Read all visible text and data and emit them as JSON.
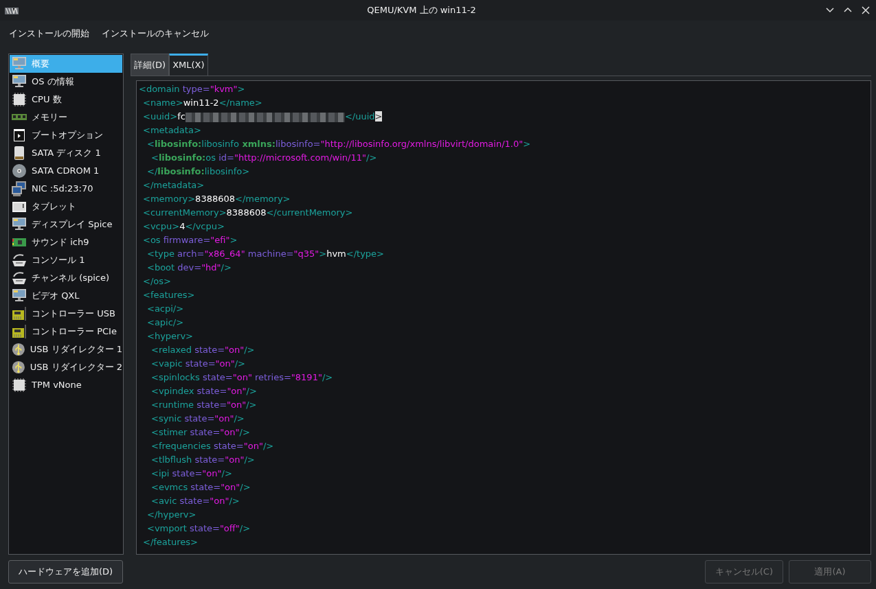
{
  "window": {
    "title": "QEMU/KVM 上の win11-2"
  },
  "menu": [
    "インストールの開始",
    "インストールのキャンセル"
  ],
  "sidebar": {
    "items": [
      {
        "label": "概要",
        "kind": "monitor",
        "selected": true
      },
      {
        "label": "OS の情報",
        "kind": "monitor",
        "selected": false
      },
      {
        "label": "CPU 数",
        "kind": "chip",
        "selected": false
      },
      {
        "label": "メモリー",
        "kind": "ram",
        "selected": false
      },
      {
        "label": "ブートオプション",
        "kind": "boot",
        "selected": false
      },
      {
        "label": "SATA ディスク 1",
        "kind": "disk",
        "selected": false
      },
      {
        "label": "SATA CDROM 1",
        "kind": "cd",
        "selected": false
      },
      {
        "label": "NIC :5d:23:70",
        "kind": "nic",
        "selected": false
      },
      {
        "label": "タブレット",
        "kind": "tablet",
        "selected": false
      },
      {
        "label": "ディスプレイ Spice",
        "kind": "monitor",
        "selected": false
      },
      {
        "label": "サウンド ich9",
        "kind": "card",
        "selected": false
      },
      {
        "label": "コンソール 1",
        "kind": "serial",
        "selected": false
      },
      {
        "label": "チャンネル (spice)",
        "kind": "serial",
        "selected": false
      },
      {
        "label": "ビデオ QXL",
        "kind": "monitor",
        "selected": false
      },
      {
        "label": "コントローラー USB",
        "kind": "controller",
        "selected": false
      },
      {
        "label": "コントローラー PCIe",
        "kind": "controller",
        "selected": false
      },
      {
        "label": "USB リダイレクター 1",
        "kind": "usb",
        "selected": false
      },
      {
        "label": "USB リダイレクター 2",
        "kind": "usb",
        "selected": false
      },
      {
        "label": "TPM vNone",
        "kind": "chip",
        "selected": false
      }
    ]
  },
  "tabs": [
    {
      "label": "詳細(D)",
      "selected": false
    },
    {
      "label": "XML(X)",
      "selected": true
    }
  ],
  "xml": [
    {
      "parts": [
        {
          "kind": "tag",
          "text": "<domain"
        },
        {
          "kind": "attr",
          "text": " type="
        },
        {
          "kind": "value",
          "text": "\"kvm\""
        },
        {
          "kind": "tag",
          "text": ">"
        }
      ],
      "children": [
        {
          "parts": [
            {
              "kind": "tag",
              "text": "<name>"
            },
            {
              "kind": "text",
              "text": "win11-2"
            },
            {
              "kind": "tag",
              "text": "</name>"
            }
          ]
        },
        {
          "parts": [
            {
              "kind": "tag",
              "text": "<uuid>"
            },
            {
              "kind": "text",
              "text": "fc"
            },
            {
              "kind": "redacted"
            },
            {
              "kind": "tag",
              "text": "</uuid"
            },
            {
              "kind": "cursor",
              "text": ">"
            }
          ]
        },
        {
          "parts": [
            {
              "kind": "tag",
              "text": "<metadata>"
            }
          ],
          "children": [
            {
              "parts": [
                {
                  "kind": "tag",
                  "text": "<"
                },
                {
                  "kind": "prefix",
                  "text": "libosinfo:"
                },
                {
                  "kind": "tag",
                  "text": "libosinfo"
                },
                {
                  "kind": "prefix",
                  "text": " xmlns:"
                },
                {
                  "kind": "attr",
                  "text": "libosinfo="
                },
                {
                  "kind": "value",
                  "text": "\"http://libosinfo.org/xmlns/libvirt/domain/1.0\""
                },
                {
                  "kind": "tag",
                  "text": ">"
                }
              ],
              "children": [
                {
                  "parts": [
                    {
                      "kind": "tag",
                      "text": "<"
                    },
                    {
                      "kind": "prefix",
                      "text": "libosinfo:"
                    },
                    {
                      "kind": "tag",
                      "text": "os"
                    },
                    {
                      "kind": "attr",
                      "text": " id="
                    },
                    {
                      "kind": "value",
                      "text": "\"http://microsoft.com/win/11\""
                    },
                    {
                      "kind": "tag",
                      "text": "/>"
                    }
                  ]
                }
              ]
            },
            {
              "parts": [
                {
                  "kind": "tag",
                  "text": "</"
                },
                {
                  "kind": "prefix",
                  "text": "libosinfo:"
                },
                {
                  "kind": "tag",
                  "text": "libosinfo>"
                }
              ]
            }
          ]
        },
        {
          "parts": [
            {
              "kind": "tag",
              "text": "</metadata>"
            }
          ]
        },
        {
          "parts": [
            {
              "kind": "tag",
              "text": "<memory>"
            },
            {
              "kind": "text",
              "text": "8388608"
            },
            {
              "kind": "tag",
              "text": "</memory>"
            }
          ]
        },
        {
          "parts": [
            {
              "kind": "tag",
              "text": "<currentMemory>"
            },
            {
              "kind": "text",
              "text": "8388608"
            },
            {
              "kind": "tag",
              "text": "</currentMemory>"
            }
          ]
        },
        {
          "parts": [
            {
              "kind": "tag",
              "text": "<vcpu>"
            },
            {
              "kind": "text",
              "text": "4"
            },
            {
              "kind": "tag",
              "text": "</vcpu>"
            }
          ]
        },
        {
          "parts": [
            {
              "kind": "tag",
              "text": "<os"
            },
            {
              "kind": "attr",
              "text": " firmware="
            },
            {
              "kind": "value",
              "text": "\"efi\""
            },
            {
              "kind": "tag",
              "text": ">"
            }
          ],
          "children": [
            {
              "parts": [
                {
                  "kind": "tag",
                  "text": "<type"
                },
                {
                  "kind": "attr",
                  "text": " arch="
                },
                {
                  "kind": "value",
                  "text": "\"x86_64\""
                },
                {
                  "kind": "attr",
                  "text": " machine="
                },
                {
                  "kind": "value",
                  "text": "\"q35\""
                },
                {
                  "kind": "tag",
                  "text": ">"
                },
                {
                  "kind": "text",
                  "text": "hvm"
                },
                {
                  "kind": "tag",
                  "text": "</type>"
                }
              ]
            },
            {
              "parts": [
                {
                  "kind": "tag",
                  "text": "<boot"
                },
                {
                  "kind": "attr",
                  "text": " dev="
                },
                {
                  "kind": "value",
                  "text": "\"hd\""
                },
                {
                  "kind": "tag",
                  "text": "/>"
                }
              ]
            }
          ]
        },
        {
          "parts": [
            {
              "kind": "tag",
              "text": "</os>"
            }
          ]
        },
        {
          "parts": [
            {
              "kind": "tag",
              "text": "<features>"
            }
          ],
          "children": [
            {
              "parts": [
                {
                  "kind": "tag",
                  "text": "<acpi/>"
                }
              ]
            },
            {
              "parts": [
                {
                  "kind": "tag",
                  "text": "<apic/>"
                }
              ]
            },
            {
              "parts": [
                {
                  "kind": "tag",
                  "text": "<hyperv>"
                }
              ],
              "children": [
                {
                  "parts": [
                    {
                      "kind": "tag",
                      "text": "<relaxed"
                    },
                    {
                      "kind": "attr",
                      "text": " state="
                    },
                    {
                      "kind": "value",
                      "text": "\"on\""
                    },
                    {
                      "kind": "tag",
                      "text": "/>"
                    }
                  ]
                },
                {
                  "parts": [
                    {
                      "kind": "tag",
                      "text": "<vapic"
                    },
                    {
                      "kind": "attr",
                      "text": " state="
                    },
                    {
                      "kind": "value",
                      "text": "\"on\""
                    },
                    {
                      "kind": "tag",
                      "text": "/>"
                    }
                  ]
                },
                {
                  "parts": [
                    {
                      "kind": "tag",
                      "text": "<spinlocks"
                    },
                    {
                      "kind": "attr",
                      "text": " state="
                    },
                    {
                      "kind": "value",
                      "text": "\"on\""
                    },
                    {
                      "kind": "attr",
                      "text": " retries="
                    },
                    {
                      "kind": "value",
                      "text": "\"8191\""
                    },
                    {
                      "kind": "tag",
                      "text": "/>"
                    }
                  ]
                },
                {
                  "parts": [
                    {
                      "kind": "tag",
                      "text": "<vpindex"
                    },
                    {
                      "kind": "attr",
                      "text": " state="
                    },
                    {
                      "kind": "value",
                      "text": "\"on\""
                    },
                    {
                      "kind": "tag",
                      "text": "/>"
                    }
                  ]
                },
                {
                  "parts": [
                    {
                      "kind": "tag",
                      "text": "<runtime"
                    },
                    {
                      "kind": "attr",
                      "text": " state="
                    },
                    {
                      "kind": "value",
                      "text": "\"on\""
                    },
                    {
                      "kind": "tag",
                      "text": "/>"
                    }
                  ]
                },
                {
                  "parts": [
                    {
                      "kind": "tag",
                      "text": "<synic"
                    },
                    {
                      "kind": "attr",
                      "text": " state="
                    },
                    {
                      "kind": "value",
                      "text": "\"on\""
                    },
                    {
                      "kind": "tag",
                      "text": "/>"
                    }
                  ]
                },
                {
                  "parts": [
                    {
                      "kind": "tag",
                      "text": "<stimer"
                    },
                    {
                      "kind": "attr",
                      "text": " state="
                    },
                    {
                      "kind": "value",
                      "text": "\"on\""
                    },
                    {
                      "kind": "tag",
                      "text": "/>"
                    }
                  ]
                },
                {
                  "parts": [
                    {
                      "kind": "tag",
                      "text": "<frequencies"
                    },
                    {
                      "kind": "attr",
                      "text": " state="
                    },
                    {
                      "kind": "value",
                      "text": "\"on\""
                    },
                    {
                      "kind": "tag",
                      "text": "/>"
                    }
                  ]
                },
                {
                  "parts": [
                    {
                      "kind": "tag",
                      "text": "<tlbflush"
                    },
                    {
                      "kind": "attr",
                      "text": " state="
                    },
                    {
                      "kind": "value",
                      "text": "\"on\""
                    },
                    {
                      "kind": "tag",
                      "text": "/>"
                    }
                  ]
                },
                {
                  "parts": [
                    {
                      "kind": "tag",
                      "text": "<ipi"
                    },
                    {
                      "kind": "attr",
                      "text": " state="
                    },
                    {
                      "kind": "value",
                      "text": "\"on\""
                    },
                    {
                      "kind": "tag",
                      "text": "/>"
                    }
                  ]
                },
                {
                  "parts": [
                    {
                      "kind": "tag",
                      "text": "<evmcs"
                    },
                    {
                      "kind": "attr",
                      "text": " state="
                    },
                    {
                      "kind": "value",
                      "text": "\"on\""
                    },
                    {
                      "kind": "tag",
                      "text": "/>"
                    }
                  ]
                },
                {
                  "parts": [
                    {
                      "kind": "tag",
                      "text": "<avic"
                    },
                    {
                      "kind": "attr",
                      "text": " state="
                    },
                    {
                      "kind": "value",
                      "text": "\"on\""
                    },
                    {
                      "kind": "tag",
                      "text": "/>"
                    }
                  ]
                }
              ]
            },
            {
              "parts": [
                {
                  "kind": "tag",
                  "text": "</hyperv>"
                }
              ]
            },
            {
              "parts": [
                {
                  "kind": "tag",
                  "text": "<vmport"
                },
                {
                  "kind": "attr",
                  "text": " state="
                },
                {
                  "kind": "value",
                  "text": "\"off\""
                },
                {
                  "kind": "tag",
                  "text": "/>"
                }
              ]
            }
          ]
        },
        {
          "parts": [
            {
              "kind": "tag",
              "text": "</features>"
            }
          ]
        }
      ]
    }
  ],
  "add_button": {
    "label": "ハードウェアを追加(D)"
  },
  "buttons": [
    {
      "label": "キャンセル(C)",
      "disabled": true
    },
    {
      "label": "適用(A)",
      "disabled": true
    }
  ]
}
